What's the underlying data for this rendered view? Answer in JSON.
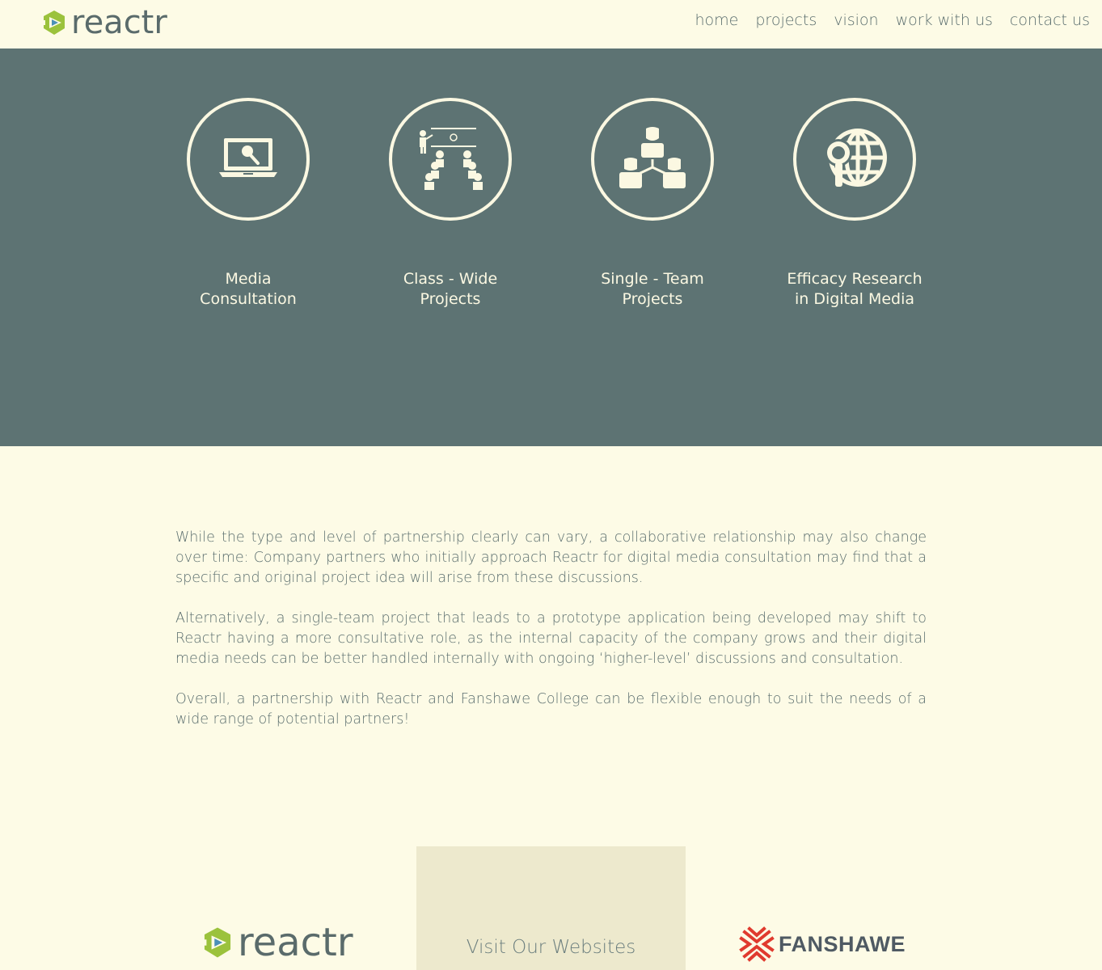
{
  "header": {
    "logo_text": "reactr",
    "nav": [
      "home",
      "projects",
      "vision",
      "work with us",
      "contact us"
    ]
  },
  "services": [
    {
      "icon": "laptop-search-icon",
      "label": "Media Consultation"
    },
    {
      "icon": "classroom-presentation-icon",
      "label": "Class - Wide Projects"
    },
    {
      "icon": "team-hierarchy-icon",
      "label": "Single - Team Projects"
    },
    {
      "icon": "globe-search-icon",
      "label": "Efficacy Research in Digital Media"
    }
  ],
  "content": {
    "paragraphs": [
      "While the type and level of partnership clearly can vary, a collaborative relationship may also change over time: Company partners who initially approach Reactr for digital media consultation may find that a specific and original project idea will arise from these discussions.",
      "Alternatively, a single-team project that leads to a prototype application being developed may shift to Reactr having a more consultative role, as the internal capacity of the company grows and their digital media needs can be better handled internally with ongoing ‘higher-level’ discussions and consultation.",
      "Overall, a partnership with Reactr and Fanshawe College can be flexible enough to suit the needs of a wide range of potential partners!"
    ]
  },
  "footer": {
    "reactr_logo_text": "reactr",
    "visit_title": "Visit Our Websites",
    "fanshawe_logo_text": "FANSHAWE"
  },
  "colors": {
    "background": "#fdfbe6",
    "band": "#5d7373",
    "text": "#5c6f6f",
    "accent_green": "#9bc23c",
    "fanshawe_red": "#e03a2e"
  }
}
